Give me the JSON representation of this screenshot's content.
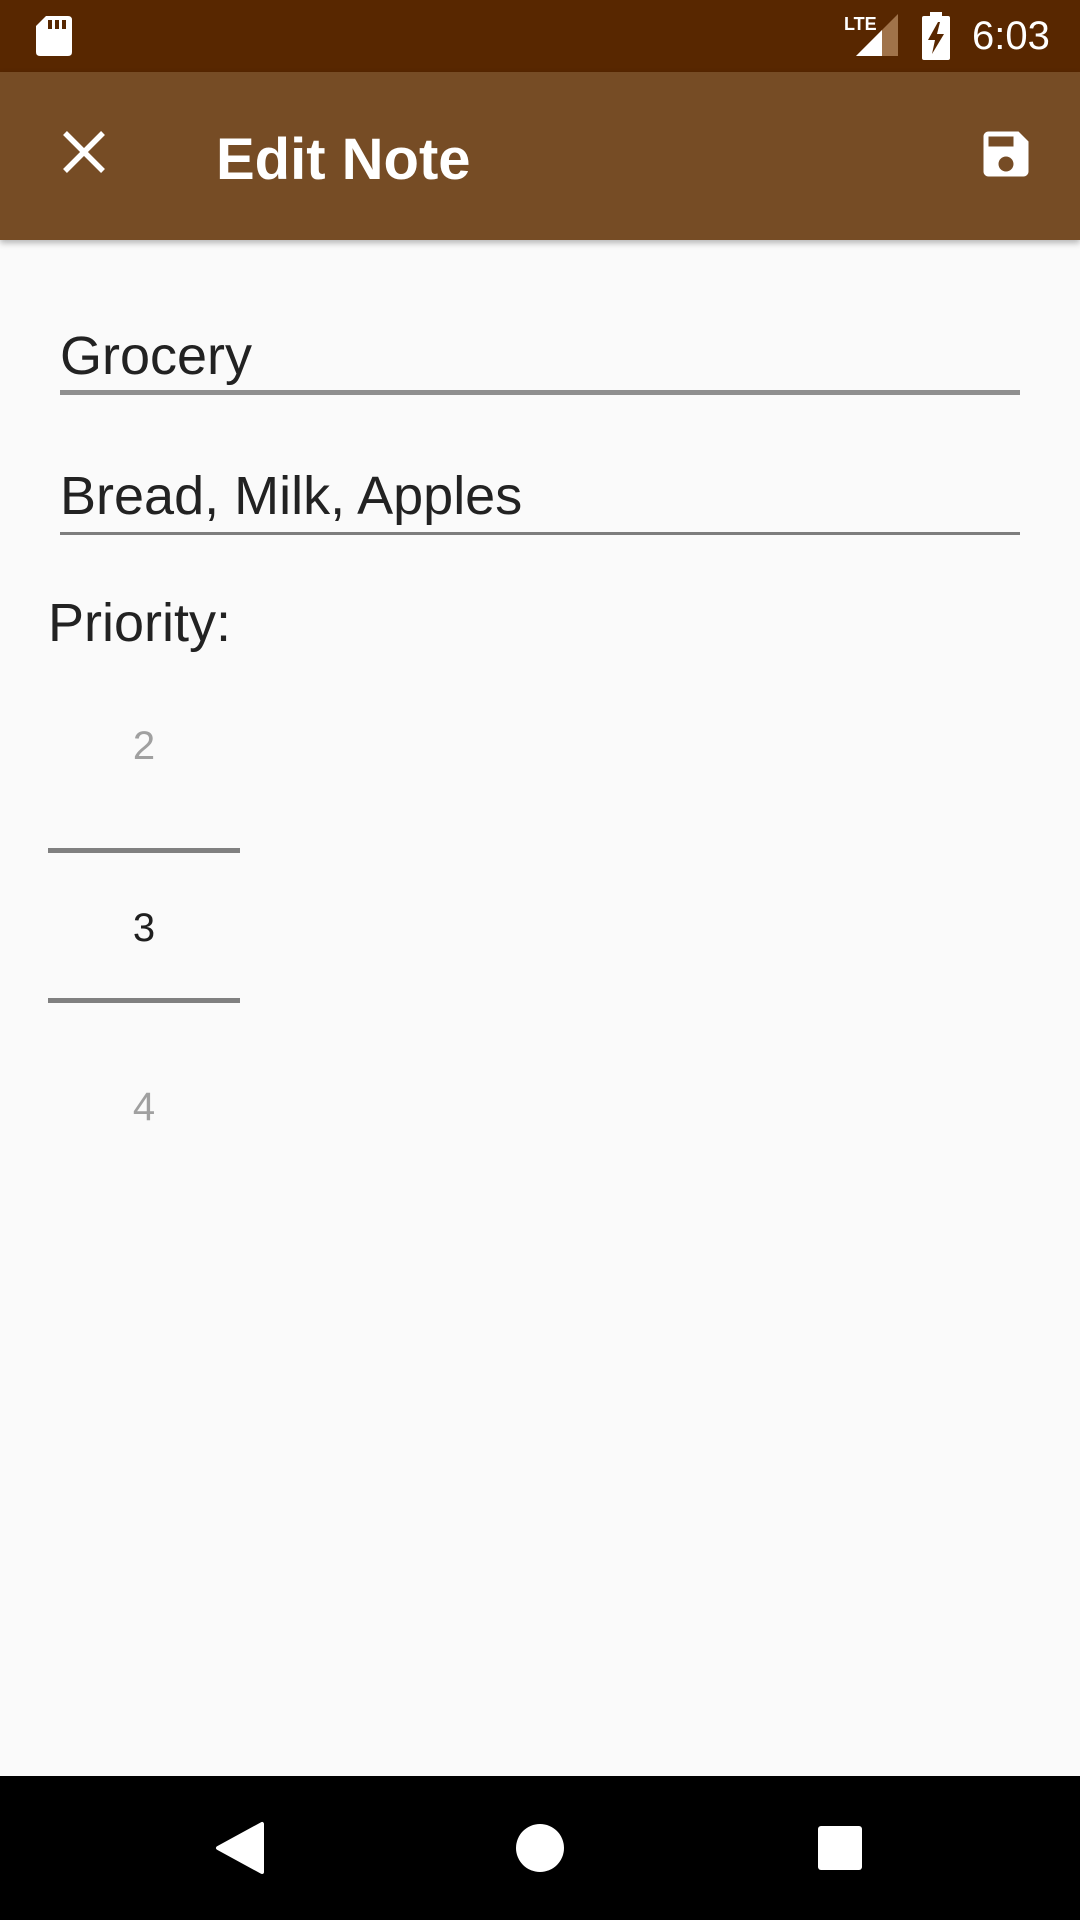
{
  "status_bar": {
    "network_label": "LTE",
    "time": "6:03",
    "icons": [
      "sd-card-icon",
      "lte-signal-icon",
      "battery-charging-icon"
    ]
  },
  "toolbar": {
    "title": "Edit Note",
    "close_icon": "close-icon",
    "save_icon": "save-icon"
  },
  "form": {
    "title_value": "Grocery",
    "description_value": "Bread, Milk, Apples",
    "priority_label": "Priority:"
  },
  "priority_picker": {
    "previous": "2",
    "selected": "3",
    "next": "4"
  },
  "nav_bar": {
    "icons": [
      "back-icon",
      "home-icon",
      "recents-icon"
    ]
  },
  "colors": {
    "status_bar": "#582700",
    "toolbar": "#764c25",
    "background": "#fafafa",
    "nav_bar": "#000000"
  }
}
